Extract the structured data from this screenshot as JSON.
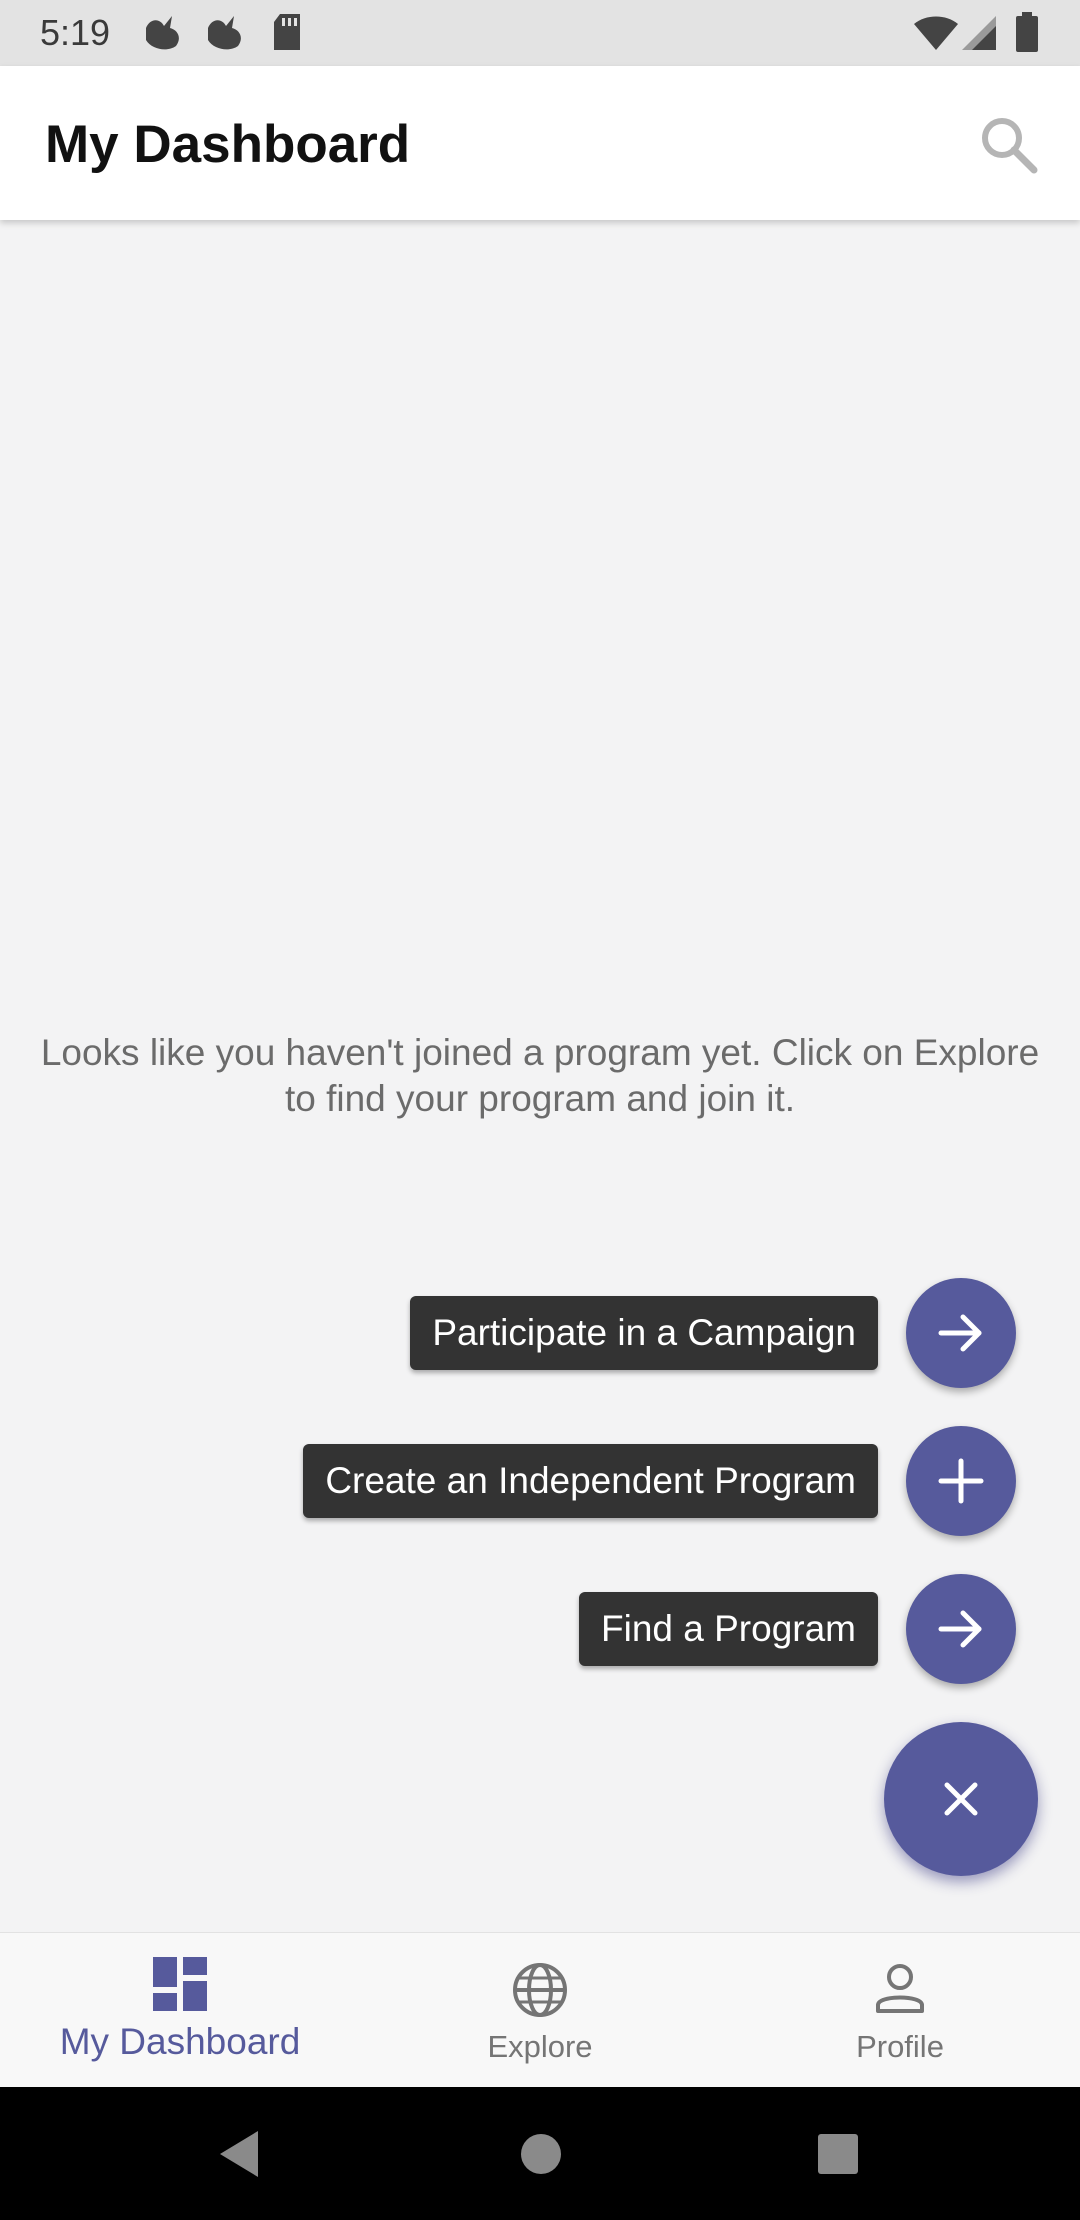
{
  "status_bar": {
    "time": "5:19",
    "icons": [
      "bird-notification-icon",
      "bird-notification-icon",
      "sd-card-icon",
      "wifi-icon",
      "signal-icon",
      "battery-icon"
    ]
  },
  "app_bar": {
    "title": "My Dashboard",
    "search_icon": "search-icon"
  },
  "main": {
    "empty_message_line1": "Looks like you haven't joined a program yet. Click on Explore",
    "empty_message_line2": "to find your program and join it."
  },
  "fab_menu": {
    "actions": [
      {
        "label": "Participate in a Campaign",
        "icon": "arrow-right-icon"
      },
      {
        "label": "Create an Independent Program",
        "icon": "plus-icon"
      },
      {
        "label": "Find a Program",
        "icon": "arrow-right-icon"
      }
    ],
    "main_icon": "close-icon"
  },
  "bottom_nav": {
    "items": [
      {
        "label": "My Dashboard",
        "icon": "dashboard-icon",
        "active": true
      },
      {
        "label": "Explore",
        "icon": "globe-icon",
        "active": false
      },
      {
        "label": "Profile",
        "icon": "person-icon",
        "active": false
      }
    ]
  },
  "colors": {
    "accent": "#565a9c",
    "background": "#f3f3f4",
    "label_bg": "#333333",
    "inactive": "#757575"
  }
}
